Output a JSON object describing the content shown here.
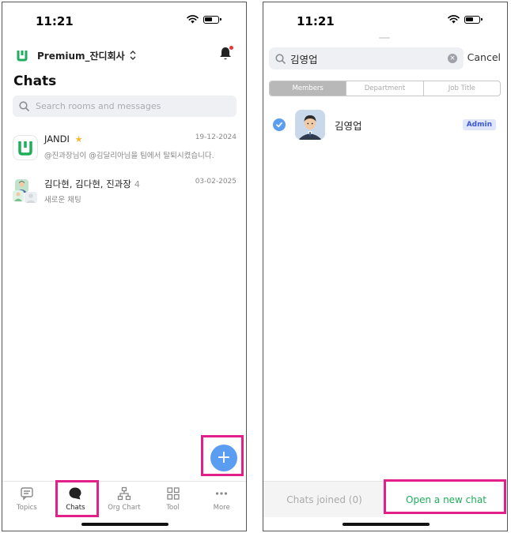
{
  "colors": {
    "accent_green": "#1fae5c",
    "fab_blue": "#5b9df0",
    "highlight_pink": "#e3208a",
    "admin_badge_bg": "#dfe6fb",
    "admin_badge_text": "#3c58d6",
    "notification_red": "#e53935"
  },
  "left": {
    "status": {
      "time": "11:21"
    },
    "header": {
      "workspace_name": "Premium_잔디회사",
      "logo_icon": "jandi-logo-icon",
      "bell_icon": "bell-icon"
    },
    "title": "Chats",
    "search": {
      "placeholder": "Search rooms and messages"
    },
    "chats": [
      {
        "name": "JANDI",
        "badge_icon": "star-icon",
        "preview": "@진과장님이 @김달리아님을 팀에서 탈퇴시켰습니다.",
        "date": "19-12-2024"
      },
      {
        "name": "김다현, 김다현, 진과장",
        "count": "4",
        "preview": "새로운 채팅",
        "date": "03-02-2025"
      }
    ],
    "fab_label": "+",
    "tabs": [
      {
        "label": "Topics",
        "icon": "topics-icon"
      },
      {
        "label": "Chats",
        "icon": "chat-bubble-icon"
      },
      {
        "label": "Org Chart",
        "icon": "org-chart-icon"
      },
      {
        "label": "Tool",
        "icon": "grid-icon"
      },
      {
        "label": "More",
        "icon": "more-dots-icon"
      }
    ]
  },
  "right": {
    "status": {
      "time": "11:21"
    },
    "search": {
      "value": "김영업",
      "cancel_label": "Cancel"
    },
    "segments": [
      "Members",
      "Department",
      "Job Title"
    ],
    "member": {
      "name": "김영업",
      "badge": "Admin"
    },
    "bottom": {
      "joined_label": "Chats joined (0)",
      "open_label": "Open a new chat"
    }
  }
}
